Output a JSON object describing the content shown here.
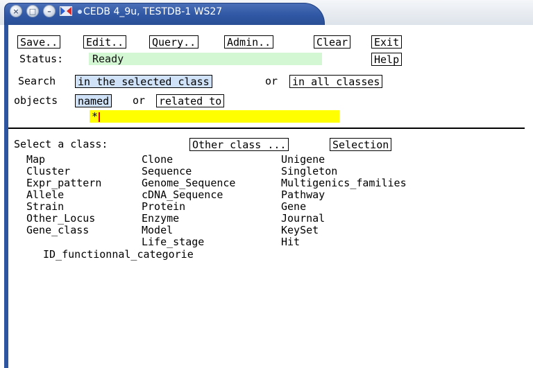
{
  "window": {
    "title": "CEDB 4_9u, TESTDB-1 WS27",
    "close_glyph": "×",
    "maximize_glyph": "□",
    "minimize_glyph": "–",
    "accent": "#2f57a3"
  },
  "toolbar": {
    "save": "Save..",
    "edit": "Edit..",
    "query": "Query..",
    "admin": "Admin..",
    "clear": "Clear",
    "exit": "Exit",
    "help": "Help"
  },
  "status": {
    "label": "Status:",
    "value": "Ready",
    "color": "#d3f7d3"
  },
  "search": {
    "label": "Search",
    "scope_selected": "in the selected class",
    "or1": "or",
    "scope_all": "in all classes",
    "objects_label": "objects",
    "mode_named": "named",
    "or2": "or",
    "mode_related": "related to",
    "query_value": "*",
    "query_color": "#ffff00"
  },
  "class_panel": {
    "prompt": "Select a class:",
    "other_class": "Other class ...",
    "selection": "Selection",
    "col1": [
      "Map",
      "Cluster",
      "Expr_pattern",
      "Allele",
      "Strain",
      "Other_Locus",
      "Gene_class"
    ],
    "col2": [
      "Clone",
      "Sequence",
      "Genome_Sequence",
      "cDNA_Sequence",
      "Protein",
      "Enzyme",
      "Model",
      "Life_stage"
    ],
    "col3": [
      "Unigene",
      "Singleton",
      "Multigenics_families",
      "Pathway",
      "Gene",
      "Journal",
      "KeySet",
      "Hit"
    ],
    "extra": "ID_functionnal_categorie"
  }
}
